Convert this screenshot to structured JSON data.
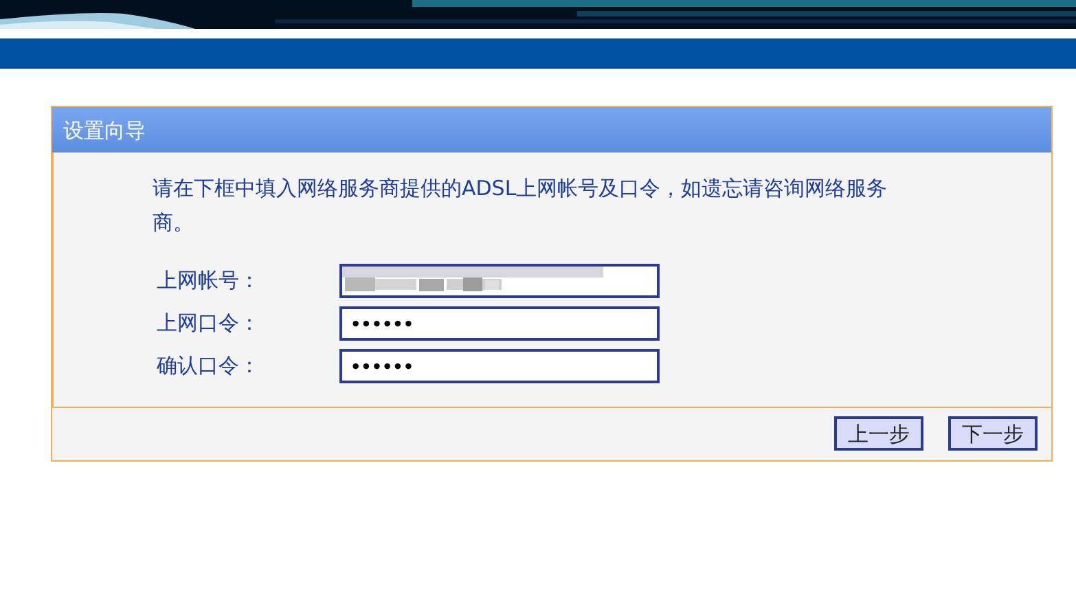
{
  "panel": {
    "title": "设置向导"
  },
  "instruction": "请在下框中填入网络服务商提供的ADSL上网帐号及口令，如遗忘请咨询网络服务商。",
  "fields": [
    {
      "label": "上网帐号：",
      "kind": "blurred"
    },
    {
      "label": "上网口令：",
      "kind": "text",
      "value": "••••••"
    },
    {
      "label": "确认口令：",
      "kind": "text",
      "value": "••••••"
    }
  ],
  "buttons": [
    "上一步",
    "下一步"
  ]
}
